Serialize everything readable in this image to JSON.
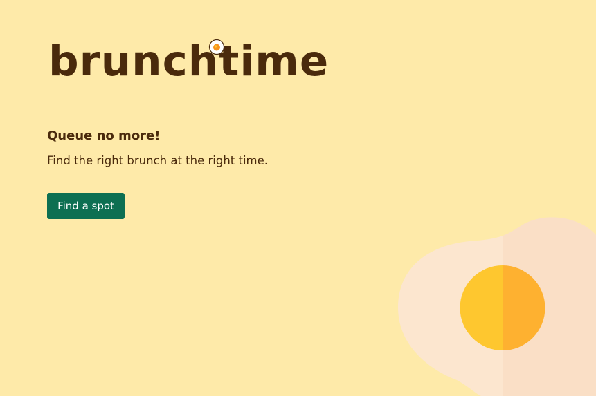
{
  "brand": {
    "logo_text": "brunchtime",
    "logo_icon": "fried-egg-icon"
  },
  "hero": {
    "headline": "Queue no more!",
    "tagline": "Find the right brunch at the right time.",
    "cta_label": "Find a spot",
    "illustration": "fried-egg-illustration"
  },
  "colors": {
    "background": "#FEEAA9",
    "text": "#4A2A0C",
    "button": "#0D6F52",
    "button_text": "#FFFFFF",
    "egg_white_light": "#FCE6CF",
    "egg_white_shade": "#FADFC6",
    "yolk_light": "#FEC72F",
    "yolk_shade": "#FEB130"
  }
}
